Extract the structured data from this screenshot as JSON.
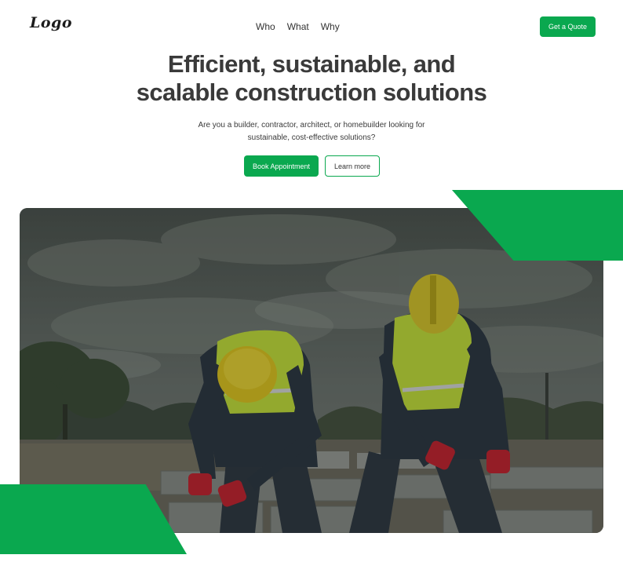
{
  "header": {
    "logo_text": "Logo",
    "nav": [
      {
        "label": "Who"
      },
      {
        "label": "What"
      },
      {
        "label": "Why"
      }
    ],
    "quote_button": "Get a Quote"
  },
  "hero": {
    "title_line1": "Efficient, sustainable, and",
    "title_line2": "scalable construction solutions",
    "subtitle_line1": "Are you a builder, contractor, architect, or homebuilder looking for",
    "subtitle_line2": "sustainable, cost-effective solutions?",
    "primary_cta": "Book Appointment",
    "secondary_cta": "Learn more"
  },
  "colors": {
    "accent_green": "#0aa84f",
    "heading": "#3a3a3a"
  },
  "photo": {
    "subject": "construction workers laying concrete blocks"
  }
}
